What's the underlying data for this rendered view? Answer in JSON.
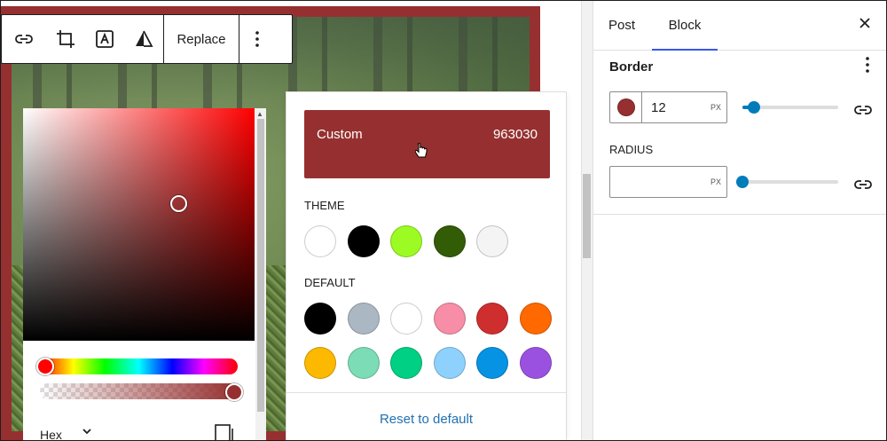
{
  "toolbar": {
    "link_icon": "link-icon",
    "crop_icon": "crop-icon",
    "text_overlay_icon": "text-overlay-icon",
    "duotone_icon": "duotone-icon",
    "replace_label": "Replace",
    "more_icon": "more-vertical-icon"
  },
  "color_picker": {
    "format_label": "Hex",
    "hue": 0,
    "alpha": 1,
    "copy_icon": "copy-icon"
  },
  "palette": {
    "custom": {
      "name": "Custom",
      "hex": "963030",
      "color": "#963030"
    },
    "theme_heading": "THEME",
    "theme_colors": [
      "#ffffff",
      "#000000",
      "#9bfb23",
      "#335c06",
      "#f4f4f4"
    ],
    "default_heading": "DEFAULT",
    "default_colors": [
      "#000000",
      "#abb8c3",
      "#ffffff",
      "#f78da7",
      "#cf2e2e",
      "#ff6900",
      "#fcb900",
      "#7bdcb5",
      "#00d084",
      "#8ed1fc",
      "#0693e3",
      "#9b51e0"
    ],
    "reset_label": "Reset to default"
  },
  "sidebar": {
    "tabs": [
      {
        "label": "Post"
      },
      {
        "label": "Block"
      }
    ],
    "active_tab": "Block",
    "border": {
      "title": "Border",
      "color": "#963030",
      "width_value": "12",
      "unit": "PX",
      "width_slider_fraction": 0.12
    },
    "radius": {
      "label": "RADIUS",
      "value": "",
      "unit": "PX",
      "slider_fraction": 0
    }
  },
  "accent_color": "#3858e9"
}
